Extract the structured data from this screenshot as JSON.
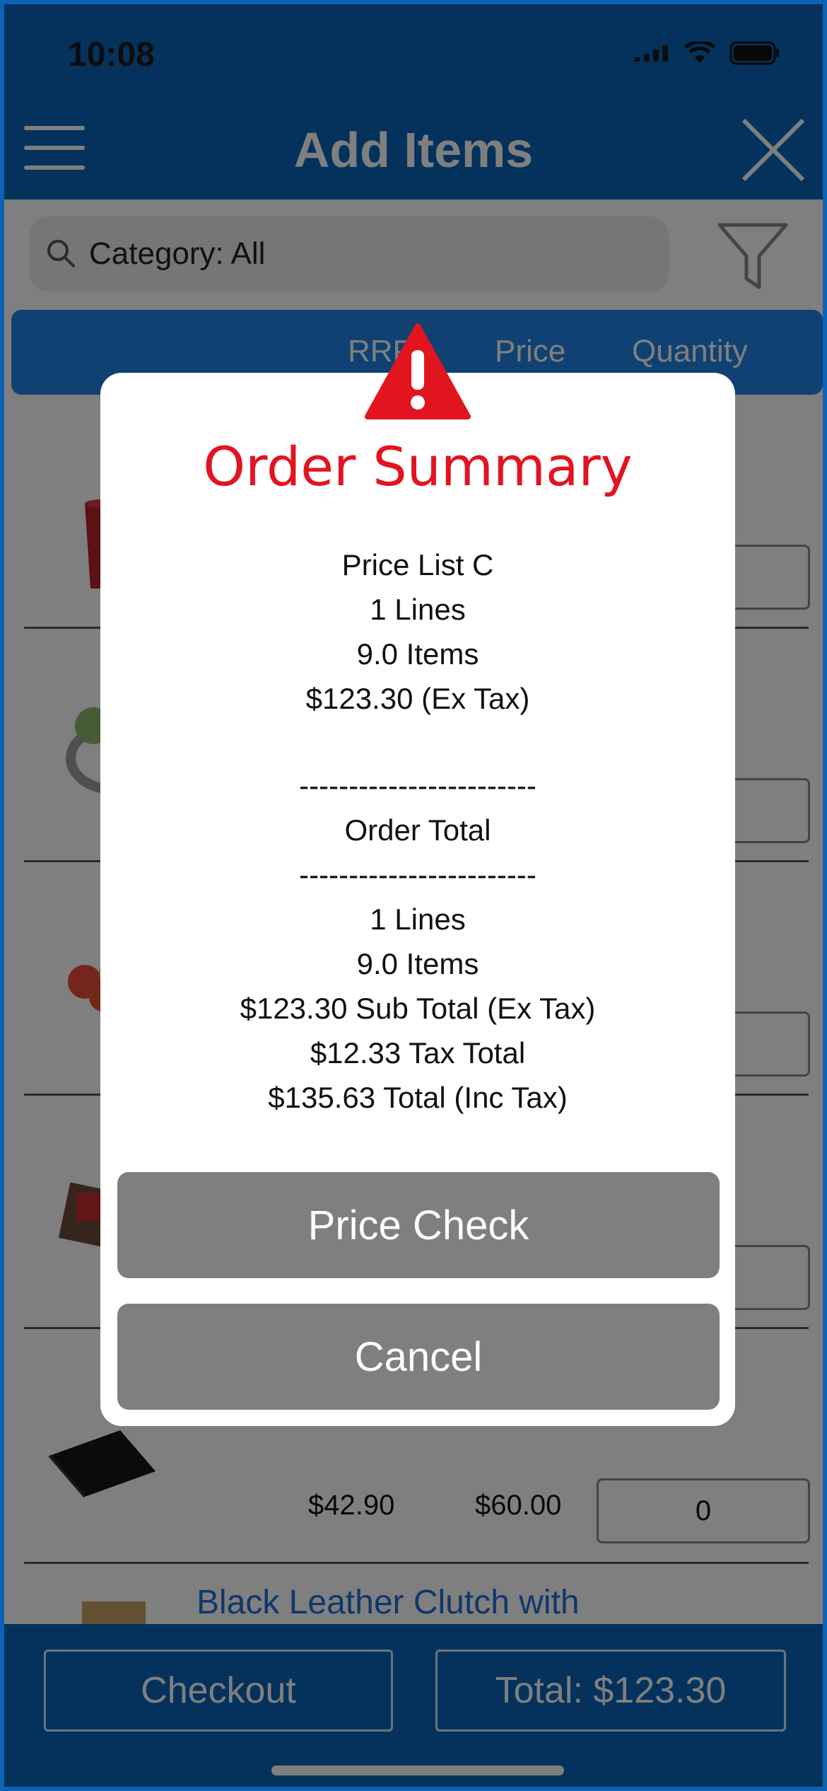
{
  "status_bar": {
    "time": "10:08"
  },
  "nav": {
    "title": "Add Items"
  },
  "search": {
    "text": "Category: All"
  },
  "columns": {
    "rrp": "RRP",
    "price": "Price",
    "quantity": "Quantity"
  },
  "visible_row": {
    "rrp": "$42.90",
    "price": "$60.00",
    "quantity": "0"
  },
  "peek_item": {
    "name": "Black Leather Clutch with"
  },
  "bottom": {
    "checkout": "Checkout",
    "total": "Total: $123.30"
  },
  "modal": {
    "title": "Order Summary",
    "price_list": "Price List C",
    "lines": "1 Lines",
    "items": "9.0 Items",
    "ex_tax": "$123.30 (Ex Tax)",
    "divider": "------------------------",
    "order_total_label": "Order Total",
    "lines_2": "1 Lines",
    "items_2": "9.0 Items",
    "sub_total": "$123.30 Sub Total (Ex Tax)",
    "tax_total": "$12.33 Tax Total",
    "total_inc": "$135.63 Total (Inc Tax)",
    "price_check": "Price Check",
    "cancel": "Cancel"
  },
  "colors": {
    "brand_blue": "#0a64b8",
    "header_blue": "#1f83e5",
    "alert_red": "#e2141f",
    "button_gray": "#7f7f7f"
  }
}
